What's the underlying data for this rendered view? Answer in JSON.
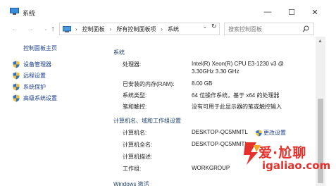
{
  "window": {
    "title": "系统",
    "minimize_glyph": "—",
    "maximize_glyph": "☐",
    "close_glyph": "✕"
  },
  "address_bar": {
    "breadcrumbs": [
      "控制面板",
      "所有控制面板项",
      "系统"
    ],
    "separator": "›",
    "search_placeholder": "搜索控制面板"
  },
  "sidebar": {
    "home_link": "控制面板主页",
    "items": [
      {
        "label": "设备管理器",
        "icon": "shield-icon"
      },
      {
        "label": "远程设置",
        "icon": "shield-icon"
      },
      {
        "label": "系统保护",
        "icon": "shield-icon"
      },
      {
        "label": "高级系统设置",
        "icon": "shield-icon"
      }
    ]
  },
  "system_section": {
    "heading": "系统",
    "rows": [
      {
        "label": "处理器:",
        "value": "Intel(R) Xeon(R) CPU E3-1230 v3 @",
        "value2": "3.30GHz   3.30 GHz"
      },
      {
        "label": "已安装的内存(RAM):",
        "value": "8.00 GB"
      },
      {
        "label": "系统类型:",
        "value": "64 位操作系统，基于 x64 的处理器"
      },
      {
        "label": "笔和触控:",
        "value": "没有可用于此显示器的笔或触控输入"
      }
    ]
  },
  "computer_section": {
    "heading": "计算机名、域和工作组设置",
    "change_settings": "更改设置",
    "rows": [
      {
        "label": "计算机名:",
        "value": "DESKTOP-QC5MMTL"
      },
      {
        "label": "计算机全名:",
        "value": "DESKTOP-QC5MMTL"
      },
      {
        "label": "计算机描述:",
        "value": ""
      },
      {
        "label": "工作组:",
        "value": "WORKGROUP"
      }
    ]
  },
  "activation_section": {
    "heading": "Windows 激活"
  },
  "watermark": {
    "line1": "爱·尬聊",
    "line2": "igaliao.com"
  },
  "colors": {
    "link": "#1a3e8a",
    "section_heading": "#1f3f6e",
    "watermark": "#e4312c"
  }
}
